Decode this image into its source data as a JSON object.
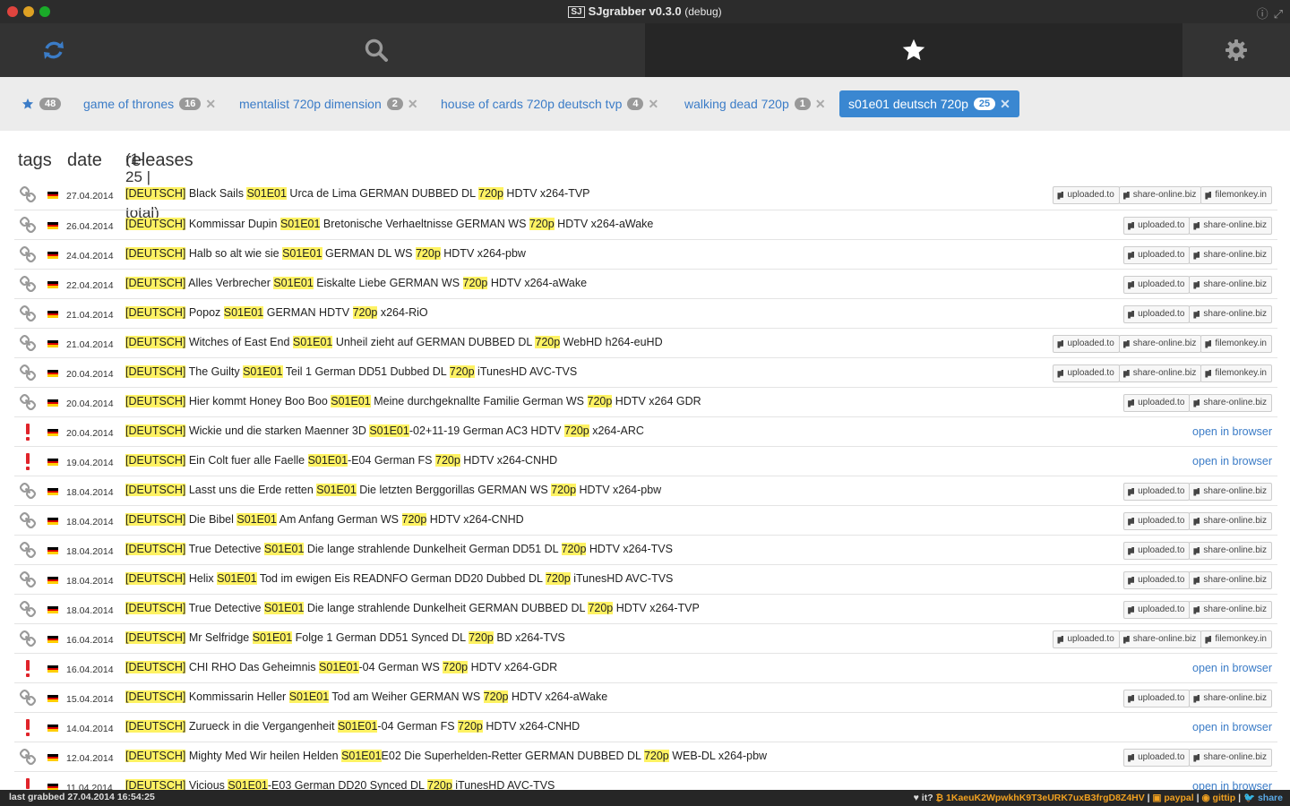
{
  "window": {
    "title": "SJgrabber v0.3.0",
    "title_suffix": "(debug)",
    "logo_text": "SJ"
  },
  "nav": {
    "items": [
      {
        "icon": "refresh-icon",
        "color": "#3b7cc7"
      },
      {
        "icon": "search-icon",
        "color": "#999999"
      },
      {
        "icon": "star-icon",
        "color": "#ffffff",
        "active": true
      },
      {
        "icon": "gear-icon",
        "color": "#999999"
      }
    ]
  },
  "tags": {
    "favorites_count": "48",
    "items": [
      {
        "label": "game of thrones",
        "count": "16"
      },
      {
        "label": "mentalist 720p dimension",
        "count": "2"
      },
      {
        "label": "house of cards 720p deutsch tvp",
        "count": "4"
      },
      {
        "label": "walking dead 720p",
        "count": "1"
      },
      {
        "label": "s01e01 deutsch 720p",
        "count": "25",
        "active": true
      }
    ]
  },
  "headers": {
    "tags": "tags",
    "date": "date",
    "releases": "releases",
    "releases_sub": "(1-25 | 25 total)"
  },
  "rows": [
    {
      "status": "link",
      "date": "27.04.2014",
      "parts": [
        "",
        "[DEUTSCH]",
        " Black Sails ",
        "S01E01",
        " Urca de Lima GERMAN DUBBED DL ",
        "720p",
        " HDTV x264-TVP"
      ],
      "hosts": [
        "uploaded.to",
        "share-online.biz",
        "filemonkey.in"
      ]
    },
    {
      "status": "link",
      "date": "26.04.2014",
      "parts": [
        "",
        "[DEUTSCH]",
        " Kommissar Dupin ",
        "S01E01",
        " Bretonische Verhaeltnisse GERMAN WS ",
        "720p",
        " HDTV x264-aWake"
      ],
      "hosts": [
        "uploaded.to",
        "share-online.biz"
      ]
    },
    {
      "status": "link",
      "date": "24.04.2014",
      "parts": [
        "",
        "[DEUTSCH]",
        " Halb so alt wie sie ",
        "S01E01",
        " GERMAN DL WS ",
        "720p",
        " HDTV x264-pbw"
      ],
      "hosts": [
        "uploaded.to",
        "share-online.biz"
      ]
    },
    {
      "status": "link",
      "date": "22.04.2014",
      "parts": [
        "",
        "[DEUTSCH]",
        " Alles Verbrecher ",
        "S01E01",
        " Eiskalte Liebe GERMAN WS ",
        "720p",
        " HDTV x264-aWake"
      ],
      "hosts": [
        "uploaded.to",
        "share-online.biz"
      ]
    },
    {
      "status": "link",
      "date": "21.04.2014",
      "parts": [
        "",
        "[DEUTSCH]",
        " Popoz ",
        "S01E01",
        " GERMAN HDTV ",
        "720p",
        " x264-RiO"
      ],
      "hosts": [
        "uploaded.to",
        "share-online.biz"
      ]
    },
    {
      "status": "link",
      "date": "21.04.2014",
      "parts": [
        "",
        "[DEUTSCH]",
        " Witches of East End ",
        "S01E01",
        " Unheil zieht auf GERMAN DUBBED DL ",
        "720p",
        " WebHD h264-euHD"
      ],
      "hosts": [
        "uploaded.to",
        "share-online.biz",
        "filemonkey.in"
      ]
    },
    {
      "status": "link",
      "date": "20.04.2014",
      "parts": [
        "",
        "[DEUTSCH]",
        " The Guilty ",
        "S01E01",
        " Teil 1 German DD51 Dubbed DL ",
        "720p",
        " iTunesHD AVC-TVS"
      ],
      "hosts": [
        "uploaded.to",
        "share-online.biz",
        "filemonkey.in"
      ]
    },
    {
      "status": "link",
      "date": "20.04.2014",
      "parts": [
        "",
        "[DEUTSCH]",
        " Hier kommt Honey Boo Boo ",
        "S01E01",
        " Meine durchgeknallte Familie German WS ",
        "720p",
        " HDTV x264 GDR"
      ],
      "hosts": [
        "uploaded.to",
        "share-online.biz"
      ]
    },
    {
      "status": "alert",
      "date": "20.04.2014",
      "parts": [
        "",
        "[DEUTSCH]",
        " Wickie und die starken Maenner 3D ",
        "S01E01",
        "-02+11-19 German AC3 HDTV ",
        "720p",
        " x264-ARC"
      ],
      "open": "open in browser"
    },
    {
      "status": "alert",
      "date": "19.04.2014",
      "parts": [
        "",
        "[DEUTSCH]",
        " Ein Colt fuer alle Faelle ",
        "S01E01",
        "-E04 German FS ",
        "720p",
        " HDTV x264-CNHD"
      ],
      "open": "open in browser"
    },
    {
      "status": "link",
      "date": "18.04.2014",
      "parts": [
        "",
        "[DEUTSCH]",
        " Lasst uns die Erde retten ",
        "S01E01",
        " Die letzten Berggorillas GERMAN WS ",
        "720p",
        " HDTV x264-pbw"
      ],
      "hosts": [
        "uploaded.to",
        "share-online.biz"
      ]
    },
    {
      "status": "link",
      "date": "18.04.2014",
      "parts": [
        "",
        "[DEUTSCH]",
        " Die Bibel ",
        "S01E01",
        " Am Anfang German WS ",
        "720p",
        " HDTV x264-CNHD"
      ],
      "hosts": [
        "uploaded.to",
        "share-online.biz"
      ]
    },
    {
      "status": "link",
      "date": "18.04.2014",
      "parts": [
        "",
        "[DEUTSCH]",
        " True Detective ",
        "S01E01",
        " Die lange strahlende Dunkelheit German DD51 DL ",
        "720p",
        " HDTV x264-TVS"
      ],
      "hosts": [
        "uploaded.to",
        "share-online.biz"
      ]
    },
    {
      "status": "link",
      "date": "18.04.2014",
      "parts": [
        "",
        "[DEUTSCH]",
        " Helix ",
        "S01E01",
        " Tod im ewigen Eis READNFO German DD20 Dubbed DL ",
        "720p",
        " iTunesHD AVC-TVS"
      ],
      "hosts": [
        "uploaded.to",
        "share-online.biz"
      ]
    },
    {
      "status": "link",
      "date": "18.04.2014",
      "parts": [
        "",
        "[DEUTSCH]",
        " True Detective ",
        "S01E01",
        " Die lange strahlende Dunkelheit GERMAN DUBBED DL ",
        "720p",
        " HDTV x264-TVP"
      ],
      "hosts": [
        "uploaded.to",
        "share-online.biz"
      ]
    },
    {
      "status": "link",
      "date": "16.04.2014",
      "parts": [
        "",
        "[DEUTSCH]",
        " Mr Selfridge ",
        "S01E01",
        " Folge 1 German DD51 Synced DL ",
        "720p",
        " BD x264-TVS"
      ],
      "hosts": [
        "uploaded.to",
        "share-online.biz",
        "filemonkey.in"
      ]
    },
    {
      "status": "alert",
      "date": "16.04.2014",
      "parts": [
        "",
        "[DEUTSCH]",
        " CHI RHO Das Geheimnis ",
        "S01E01",
        "-04 German WS ",
        "720p",
        " HDTV x264-GDR"
      ],
      "open": "open in browser"
    },
    {
      "status": "link",
      "date": "15.04.2014",
      "parts": [
        "",
        "[DEUTSCH]",
        " Kommissarin Heller ",
        "S01E01",
        " Tod am Weiher GERMAN WS ",
        "720p",
        " HDTV x264-aWake"
      ],
      "hosts": [
        "uploaded.to",
        "share-online.biz"
      ]
    },
    {
      "status": "alert",
      "date": "14.04.2014",
      "parts": [
        "",
        "[DEUTSCH]",
        " Zurueck in die Vergangenheit ",
        "S01E01",
        "-04 German FS ",
        "720p",
        " HDTV x264-CNHD"
      ],
      "open": "open in browser"
    },
    {
      "status": "link",
      "date": "12.04.2014",
      "parts": [
        "",
        "[DEUTSCH]",
        " Mighty Med Wir heilen Helden ",
        "S01E01",
        "E02 Die Superhelden-Retter GERMAN DUBBED DL ",
        "720p",
        " WEB-DL x264-pbw"
      ],
      "hosts": [
        "uploaded.to",
        "share-online.biz"
      ]
    },
    {
      "status": "alert",
      "date": "11.04.2014",
      "parts": [
        "",
        "[DEUTSCH]",
        " Vicious ",
        "S01E01",
        "-E03 German DD20 Synced DL ",
        "720p",
        " iTunesHD AVC-TVS"
      ],
      "open": "open in browser"
    }
  ],
  "status": {
    "last_grabbed": "last grabbed 27.04.2014 16:54:25",
    "it_label": "it?",
    "bitcoin": "1KaeuK2WpwkhK9T3eURK7uxB3frgD8Z4HV",
    "paypal": "paypal",
    "gittip": "gittip",
    "share": "share"
  },
  "colors": {
    "accent": "#3b7cc7",
    "highlight": "#fef263",
    "alert": "#e0232a"
  }
}
